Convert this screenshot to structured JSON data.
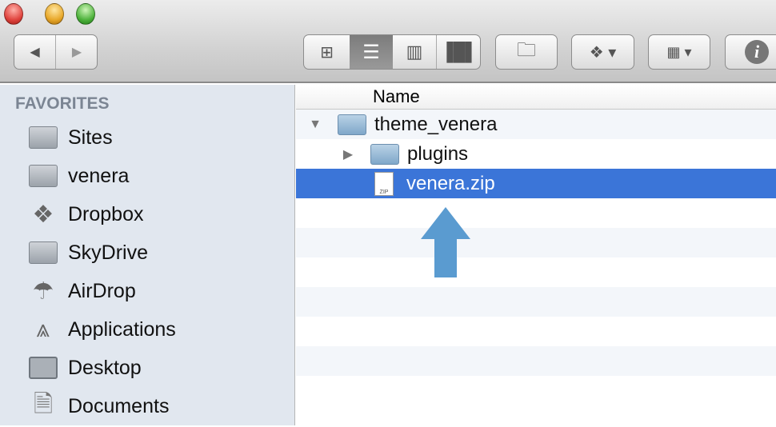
{
  "window": {
    "traffic_lights": {
      "close": "#e0443e",
      "minimize": "#e8a82a",
      "zoom": "#4fb33d"
    }
  },
  "toolbar": {
    "view_modes": [
      "icon-view",
      "list-view",
      "column-view",
      "coverflow-view"
    ],
    "selected_view": "list-view"
  },
  "sidebar": {
    "heading": "FAVORITES",
    "items": [
      {
        "label": "Sites",
        "icon": "folder-icon"
      },
      {
        "label": "venera",
        "icon": "folder-icon"
      },
      {
        "label": "Dropbox",
        "icon": "dropbox-icon"
      },
      {
        "label": "SkyDrive",
        "icon": "folder-icon"
      },
      {
        "label": "AirDrop",
        "icon": "airdrop-icon"
      },
      {
        "label": "Applications",
        "icon": "applications-icon"
      },
      {
        "label": "Desktop",
        "icon": "desktop-icon"
      },
      {
        "label": "Documents",
        "icon": "documents-icon"
      }
    ]
  },
  "list": {
    "column_name": "Name",
    "rows": [
      {
        "name": "theme_venera",
        "type": "folder",
        "expanded": true
      },
      {
        "name": "plugins",
        "type": "folder",
        "expanded": false
      },
      {
        "name": "venera.zip",
        "type": "zip",
        "selected": true,
        "badge": "ZIP"
      }
    ]
  },
  "colors": {
    "selection": "#3b75d8",
    "arrow": "#5a9bd0"
  }
}
